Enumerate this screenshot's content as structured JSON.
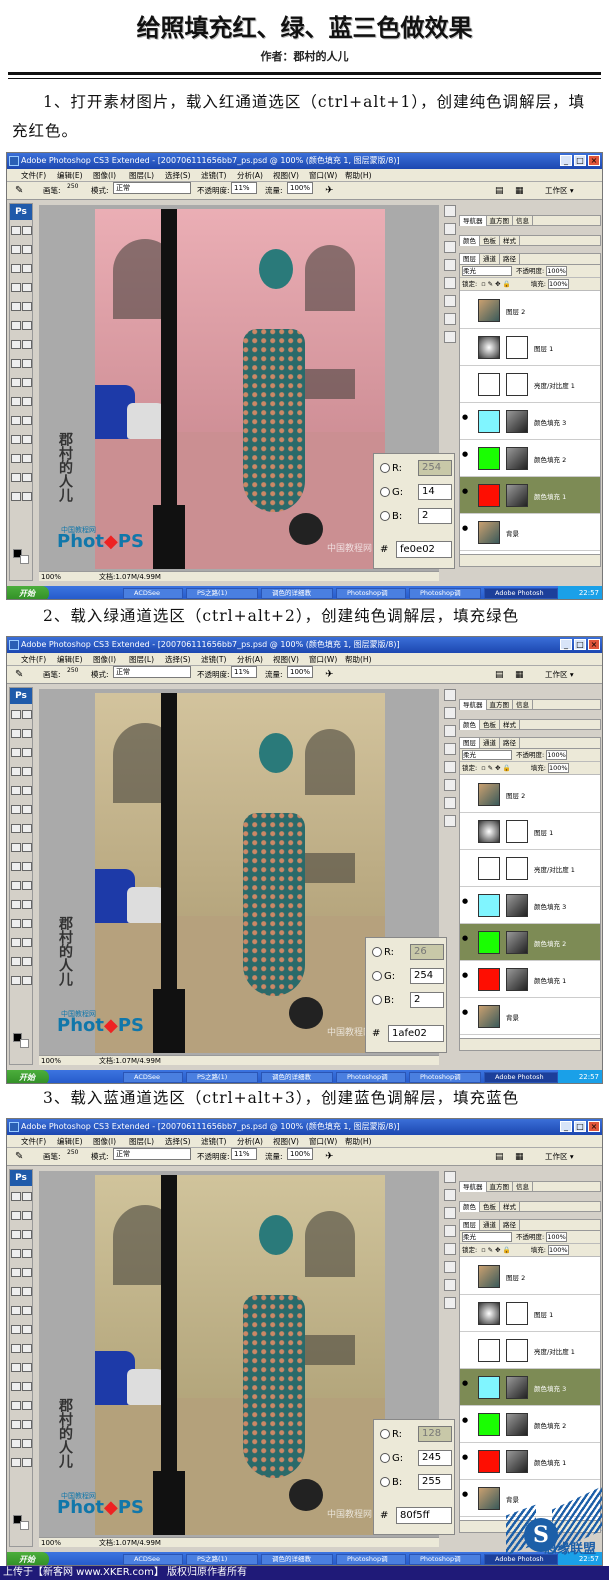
{
  "header": {
    "title": "给照填充红、绿、蓝三色做效果",
    "author": "作者：郡村的人儿"
  },
  "steps": [
    {
      "text": "1、打开素材图片，载入红通道选区（ctrl+alt+1），创建纯色调解层，填充红色。"
    },
    {
      "text": "2、载入绿通道选区（ctrl+alt+2），创建纯色调解层，填充绿色"
    },
    {
      "text": "3、载入蓝通道选区（ctrl+alt+3），创建蓝色调解层，填充蓝色"
    }
  ],
  "photoshop": {
    "title": "Adobe Photoshop CS3 Extended - [200706111656bb7_ps.psd @ 100% (颜色填充 1, 图层蒙版/8)]",
    "menu": [
      "文件(F)",
      "编辑(E)",
      "图像(I)",
      "图层(L)",
      "选择(S)",
      "滤镜(T)",
      "分析(A)",
      "视图(V)",
      "窗口(W)",
      "帮助(H)"
    ],
    "options": {
      "brush_label": "画笔:",
      "brush_size": "250",
      "mode_label": "模式:",
      "mode_value": "正常",
      "opacity_label": "不透明度:",
      "opacity_value": "11%",
      "flow_label": "流量:",
      "flow_value": "100%",
      "workspace": "工作区 ▾"
    },
    "tool_badge": "Ps",
    "status": {
      "zoom": "100%",
      "doc": "文档:1.07M/4.99M"
    },
    "panel_tabs": {
      "nav": [
        "导航器",
        "直方图",
        "信息"
      ],
      "color": [
        "颜色",
        "色板",
        "样式"
      ],
      "layers": [
        "图层",
        "通道",
        "路径"
      ]
    },
    "layer_options": {
      "blend": "柔光",
      "opacity_label": "不透明度:",
      "opacity": "100%",
      "lock_label": "锁定:",
      "fill_label": "填充:",
      "fill": "100%"
    },
    "layers": [
      {
        "name": "图层 2",
        "thumb": "photo"
      },
      {
        "name": "图层 1",
        "thumb": "gradient"
      },
      {
        "name": "亮度/对比度 1",
        "thumb": "adjust"
      },
      {
        "name": "颜色填充 3",
        "color": "#80f5ff"
      },
      {
        "name": "颜色填充 2",
        "color": "#1afe02"
      },
      {
        "name": "颜色填充 1",
        "color": "#fe0e02"
      },
      {
        "name": "背景",
        "thumb": "photo"
      }
    ]
  },
  "watermarks": {
    "photops_a": "Phot",
    "photops_b": "PS",
    "photops_sub": "中国教程网",
    "vertical": "郡村的人儿",
    "site": "中国教程网"
  },
  "taskbar": {
    "start": "开始",
    "tasks": [
      "ACDSee",
      "PS之路(1)",
      "调色的详细教",
      "Photoshop调",
      "Photoshop调",
      "Adobe Photosh"
    ],
    "clock": "22:57"
  },
  "screens": [
    {
      "picker": {
        "r": "254",
        "g": "14",
        "b": "2",
        "hex": "fe0e02"
      },
      "active_layer": 5,
      "tint": "#e7a0a8"
    },
    {
      "picker": {
        "r": "26",
        "g": "254",
        "b": "2",
        "hex": "1afe02"
      },
      "active_layer": 4,
      "tint": "#cbb98c"
    },
    {
      "picker": {
        "r": "128",
        "g": "245",
        "b": "255",
        "hex": "80f5ff"
      },
      "active_layer": 3,
      "tint": "#c8b98a"
    }
  ],
  "picker_labels": {
    "r": "R:",
    "g": "G:",
    "b": "B:",
    "hash": "#"
  },
  "footer": {
    "text": "上传于【新客网 www.XKER.com】 版权归原作者所有",
    "logo_letter": "S",
    "logo_text": "思缘联盟"
  }
}
